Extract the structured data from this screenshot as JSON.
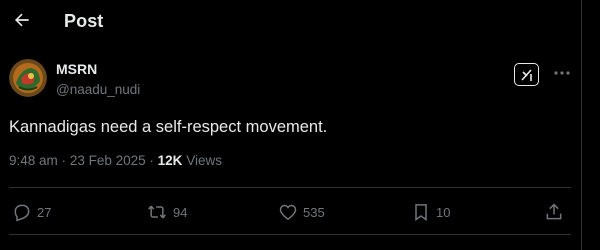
{
  "header": {
    "title": "Post",
    "back_icon": "arrow-left-icon"
  },
  "author": {
    "name": "MSRN",
    "handle": "@naadu_nudi",
    "avatar": "avatar-image"
  },
  "post": {
    "text": "Kannadigas need a self-respect movement.",
    "time": "9:48 am",
    "sep": "·",
    "date": "23 Feb 2025",
    "views_count": "12K",
    "views_label": "Views"
  },
  "actions": {
    "replies": "27",
    "reposts": "94",
    "likes": "535",
    "bookmarks": "10"
  },
  "colors": {
    "background": "#000000",
    "text": "#e7e9ea",
    "secondary": "#71767b",
    "border": "#2f3336"
  }
}
